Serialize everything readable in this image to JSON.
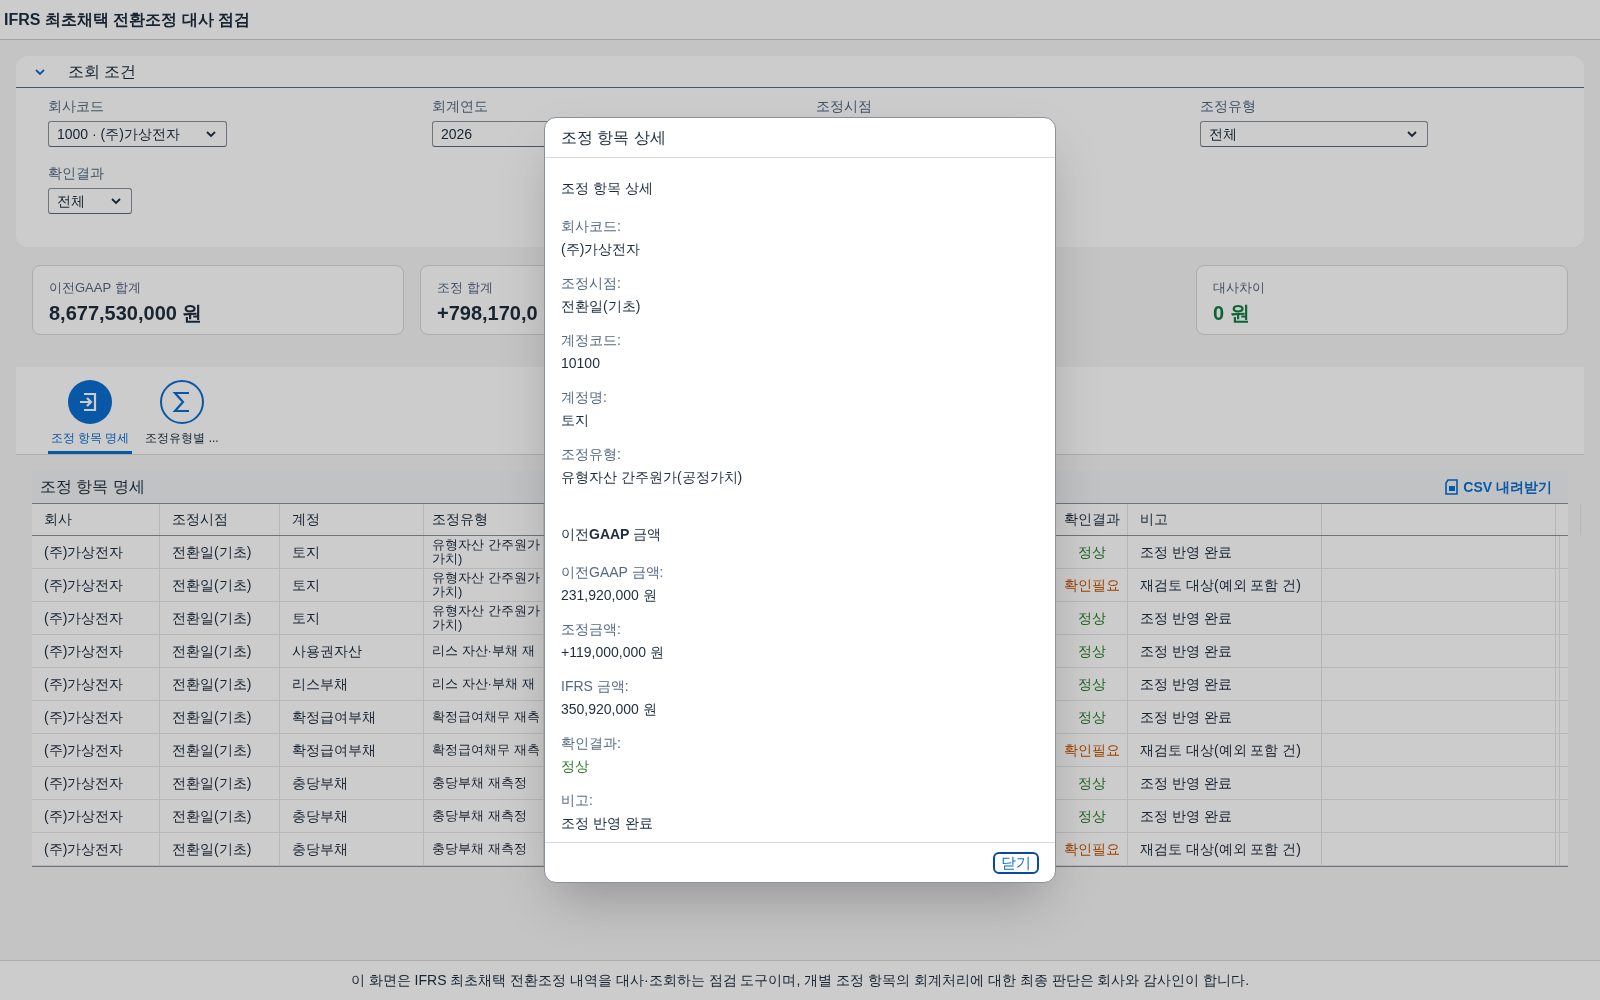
{
  "window": {
    "title": "IFRS 최초채택 전환조정 대사 점검"
  },
  "filter_panel": {
    "title": "조회 조건",
    "expanded": true,
    "fields": [
      {
        "label": "회사코드",
        "value": "1000 · (주)가상전자",
        "kind": "select"
      },
      {
        "label": "회계연도",
        "value": "2026",
        "kind": "input"
      },
      {
        "label": "조정시점",
        "kind": "hidden"
      },
      {
        "label": "조정유형",
        "value": "전체",
        "kind": "select"
      },
      {
        "label": "확인결과",
        "value": "전체",
        "kind": "select"
      }
    ]
  },
  "kpis": [
    {
      "label": "이전GAAP 합계",
      "value": "8,677,530,000 원",
      "kind": "amount"
    },
    {
      "label": "조정 합계",
      "value": "+798,170,0",
      "kind": "amount"
    },
    {
      "label": "대사차이",
      "value": "0 원",
      "kind": "ok"
    }
  ],
  "tabs": [
    {
      "label": "조정 항목 명세",
      "selected": true
    },
    {
      "label": "조정유형별 ...",
      "selected": false
    }
  ],
  "table": {
    "title": "조정 항목 명세",
    "download": "CSV 내려받기",
    "columns": [
      "회사",
      "조정시점",
      "계정",
      "조정유형",
      "확인결과",
      "비고"
    ],
    "rows": [
      {
        "cells": [
          "(주)가상전자",
          "전환일(기초)",
          "토지",
          "유형자산 간주원가 가치)",
          "정상",
          "조정 반영 완료"
        ],
        "kind": "ok"
      },
      {
        "cells": [
          "(주)가상전자",
          "전환일(기초)",
          "토지",
          "유형자산 간주원가 가치)",
          "확인필요",
          "재검토 대상(예외 포함 건)"
        ],
        "kind": "warn"
      },
      {
        "cells": [
          "(주)가상전자",
          "전환일(기초)",
          "토지",
          "유형자산 간주원가 가치)",
          "정상",
          "조정 반영 완료"
        ],
        "kind": "ok"
      },
      {
        "cells": [
          "(주)가상전자",
          "전환일(기초)",
          "사용권자산",
          "리스 자산·부채 재",
          "정상",
          "조정 반영 완료"
        ],
        "kind": "ok"
      },
      {
        "cells": [
          "(주)가상전자",
          "전환일(기초)",
          "리스부채",
          "리스 자산·부채 재",
          "정상",
          "조정 반영 완료"
        ],
        "kind": "ok"
      },
      {
        "cells": [
          "(주)가상전자",
          "전환일(기초)",
          "확정급여부채",
          "확정급여채무 재측",
          "정상",
          "조정 반영 완료"
        ],
        "kind": "ok"
      },
      {
        "cells": [
          "(주)가상전자",
          "전환일(기초)",
          "확정급여부채",
          "확정급여채무 재측",
          "확인필요",
          "재검토 대상(예외 포함 건)"
        ],
        "kind": "warn"
      },
      {
        "cells": [
          "(주)가상전자",
          "전환일(기초)",
          "충당부채",
          "충당부채 재측정",
          "정상",
          "조정 반영 완료"
        ],
        "kind": "ok"
      },
      {
        "cells": [
          "(주)가상전자",
          "전환일(기초)",
          "충당부채",
          "충당부채 재측정",
          "정상",
          "조정 반영 완료"
        ],
        "kind": "ok"
      },
      {
        "cells": [
          "(주)가상전자",
          "전환일(기초)",
          "충당부채",
          "충당부채 재측정",
          "확인필요",
          "재검토 대상(예외 포함 건)"
        ],
        "kind": "warn"
      }
    ]
  },
  "dialog": {
    "title": "조정 항목 상세",
    "sections": [
      {
        "heading": "조정 항목 상세",
        "fields": [
          {
            "label": "회사코드:",
            "value": "(주)가상전자",
            "kind": "text"
          },
          {
            "label": "조정시점:",
            "value": "전환일(기초)",
            "kind": "text"
          },
          {
            "label": "계정코드:",
            "value": "10100",
            "kind": "text"
          },
          {
            "label": "계정명:",
            "value": "토지",
            "kind": "text"
          },
          {
            "label": "조정유형:",
            "value": "유형자산 간주원가(공정가치)",
            "kind": "text"
          }
        ]
      },
      {
        "heading": "이전**GAAP** 금액",
        "fields": [
          {
            "label": "이전GAAP 금액:",
            "value": "231,920,000 원",
            "kind": "text"
          },
          {
            "label": "조정금액:",
            "value": "+119,000,000 원",
            "kind": "text"
          },
          {
            "label": "IFRS 금액:",
            "value": "350,920,000 원",
            "kind": "text"
          },
          {
            "label": "확인결과:",
            "value": "정상",
            "kind": "ok"
          },
          {
            "label": "비고:",
            "value": "조정 반영 완료",
            "kind": "text"
          }
        ]
      }
    ],
    "close_button": "닫기"
  },
  "footer": "이 화면은 IFRS 최초채택 전환조정 내역을 대사·조회하는 점검 도구이며, 개별 조정 항목의 회계처리에 대한 최종 판단은 회사와 감사인이 합니다."
}
